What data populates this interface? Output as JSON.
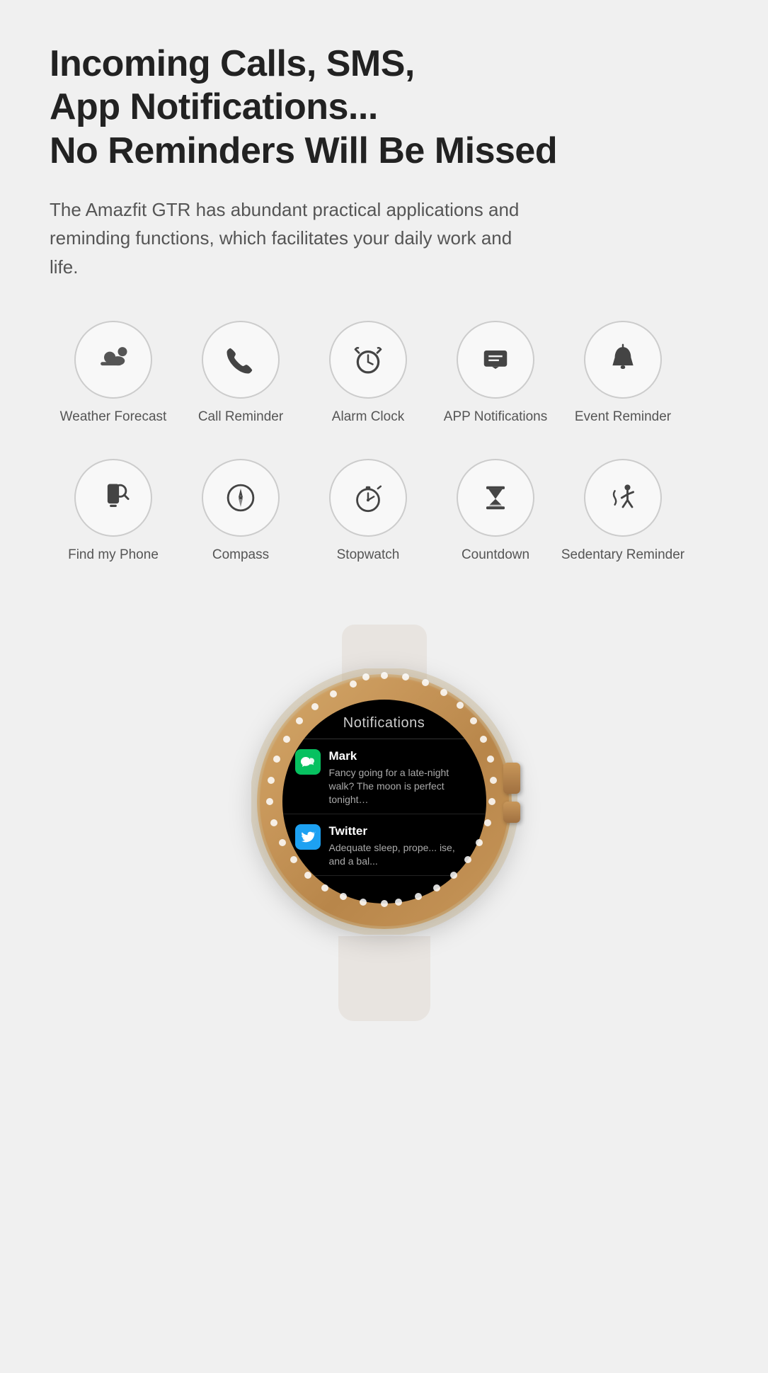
{
  "headline": {
    "line1": "Incoming Calls, SMS,",
    "line2": "App Notifications...",
    "line3": "No Reminders Will Be Missed"
  },
  "subtext": "The Amazfit GTR has abundant practical applications and reminding functions, which facilitates your daily work and life.",
  "icons_row1": [
    {
      "id": "weather-forecast",
      "label": "Weather Forecast"
    },
    {
      "id": "call-reminder",
      "label": "Call Reminder"
    },
    {
      "id": "alarm-clock",
      "label": "Alarm Clock"
    },
    {
      "id": "app-notifications",
      "label": "APP Notifications"
    },
    {
      "id": "event-reminder",
      "label": "Event Reminder"
    }
  ],
  "icons_row2": [
    {
      "id": "find-my-phone",
      "label": "Find my Phone"
    },
    {
      "id": "compass",
      "label": "Compass"
    },
    {
      "id": "stopwatch",
      "label": "Stopwatch"
    },
    {
      "id": "countdown",
      "label": "Countdown"
    },
    {
      "id": "sedentary-reminder",
      "label": "Sedentary Reminder"
    }
  ],
  "watch": {
    "screen_title": "Notifications",
    "notifications": [
      {
        "app": "WeChat",
        "sender": "Mark",
        "message": "Fancy going for a late-night walk? The moon is perfect tonight…"
      },
      {
        "app": "Twitter",
        "sender": "Twitter",
        "message": "Adequate sleep, prope... ise, and a bal..."
      }
    ]
  }
}
